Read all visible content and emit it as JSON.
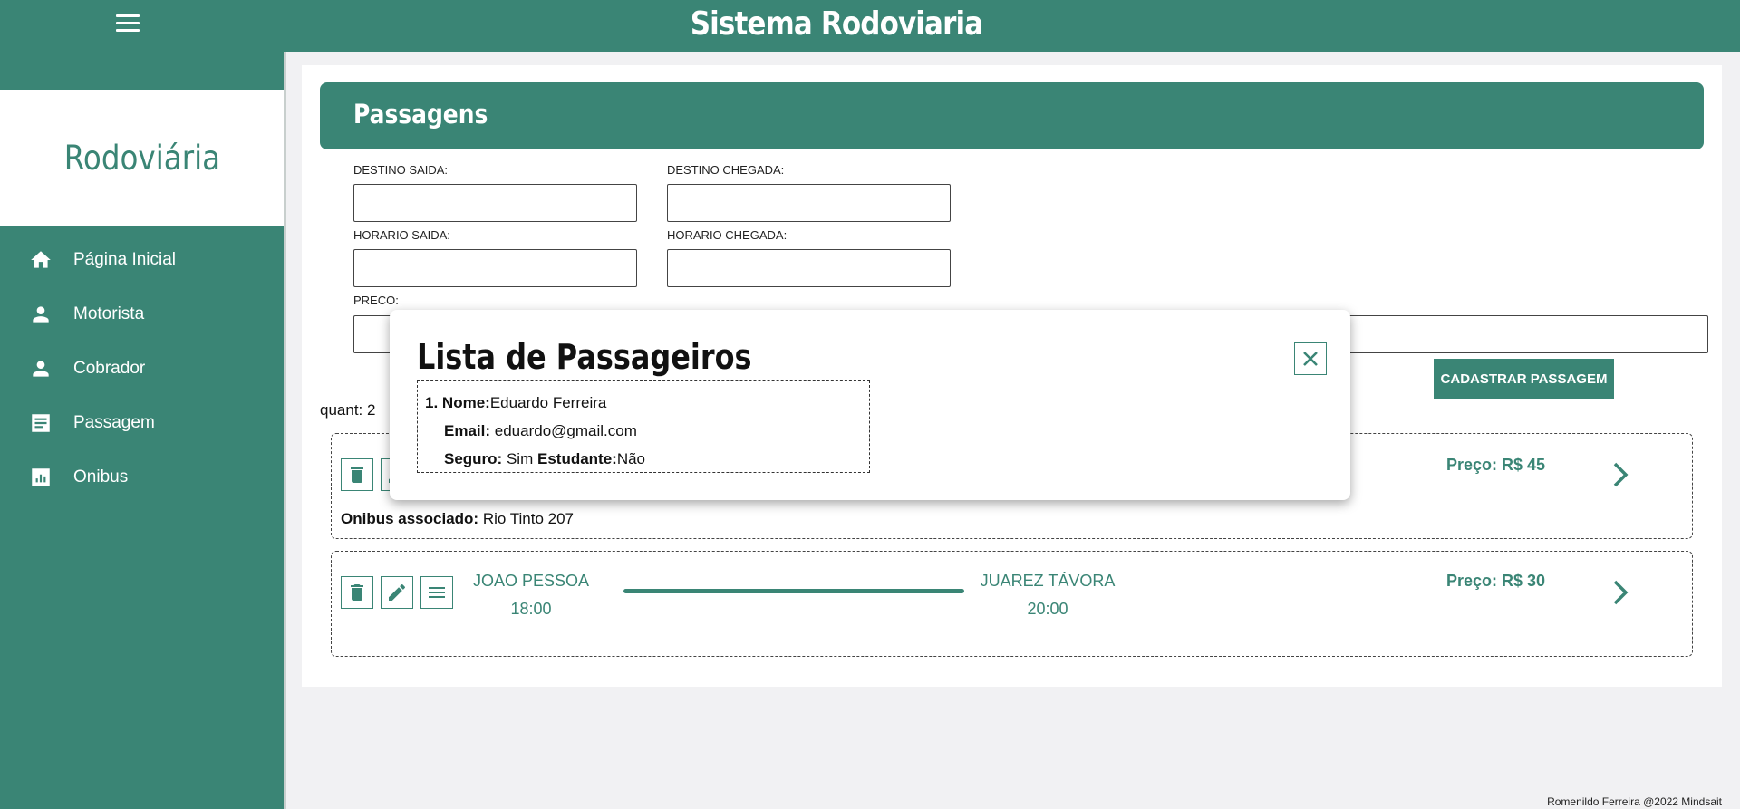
{
  "header": {
    "title": "Sistema Rodoviaria"
  },
  "sidebar": {
    "brand": "Rodoviária",
    "items": [
      {
        "label": "Página Inicial",
        "icon": "home-icon"
      },
      {
        "label": "Motorista",
        "icon": "person-icon"
      },
      {
        "label": "Cobrador",
        "icon": "person-icon"
      },
      {
        "label": "Passagem",
        "icon": "receipt-icon"
      },
      {
        "label": "Onibus",
        "icon": "chart-icon"
      }
    ]
  },
  "form": {
    "title": "Passagens",
    "destino_saida_label": "DESTINO SAIDA:",
    "destino_chegada_label": "DESTINO CHEGADA:",
    "horario_saida_label": "HORARIO SAIDA:",
    "horario_chegada_label": "HORARIO CHEGADA:",
    "preco_label": "PRECO:",
    "submit_label": "CADASTRAR PASSAGEM"
  },
  "list": {
    "quant": "quant: 2",
    "tickets": [
      {
        "price": "Preço: R$ 45",
        "bus_label": "Onibus associado:",
        "bus_value": "Rio Tinto 207"
      },
      {
        "origin": "JOAO PESSOA",
        "departure": "18:00",
        "destination": "JUAREZ TÁVORA",
        "arrival": "20:00",
        "price": "Preço: R$ 30"
      }
    ]
  },
  "modal": {
    "title": "Lista de Passageiros",
    "passengers": [
      {
        "index": "1.",
        "nome_label": "Nome:",
        "nome": "Eduardo Ferreira",
        "email_label": "Email:",
        "email": "eduardo@gmail.com",
        "seguro_label": "Seguro:",
        "seguro": "Sim",
        "estudante_label": "Estudante:",
        "estudante": "Não"
      }
    ]
  },
  "footer": {
    "text": "Romenildo Ferreira @2022 Mindsait"
  },
  "colors": {
    "primary": "#3a8575",
    "background": "#f1f1f3"
  }
}
